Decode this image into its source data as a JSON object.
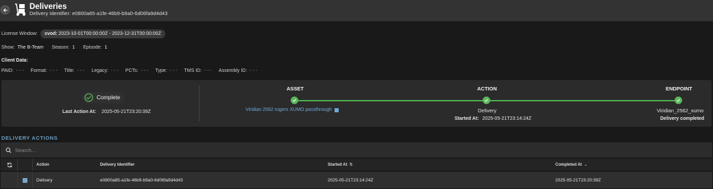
{
  "header": {
    "title": "Deliveries",
    "subtitle": "Delivery Identifier: e0800a65-a1fe-46b9-b9a0-6d06fa9d4d43"
  },
  "license": {
    "label": "License Window:",
    "type": "svod:",
    "range": "2023-10-01T00:00:00Z - 2023-12-31T00:00:00Z"
  },
  "show_info": {
    "show_label": "Show:",
    "show_value": "The B-Team",
    "season_label": "Season:",
    "season_value": "1",
    "episode_label": "Episode:",
    "episode_value": "1"
  },
  "client_data": {
    "heading": "Client Data:",
    "fields": [
      {
        "label": "PAID:",
        "value": "- - -"
      },
      {
        "label": "Format:",
        "value": "- - -"
      },
      {
        "label": "Title:",
        "value": "- - -"
      },
      {
        "label": "Legacy:",
        "value": "- - -"
      },
      {
        "label": "PCTs:",
        "value": "- - -"
      },
      {
        "label": "Type:",
        "value": "- - -"
      },
      {
        "label": "TMS ID:",
        "value": "- - -"
      },
      {
        "label": "Assembly ID:",
        "value": "- - -"
      }
    ]
  },
  "status": {
    "badge": "Complete",
    "last_action_label": "Last Action At:",
    "last_action_value": "2025-05-21T23:20:39Z"
  },
  "pipeline": {
    "asset_title": "ASSET",
    "action_title": "ACTION",
    "endpoint_title": "ENDPOINT",
    "asset_link": "Viridian 2562 rogers XUMO passthrough",
    "action_name": "Delivery",
    "started_label": "Started At:",
    "started_value": "2025-05-21T23:14:24Z",
    "endpoint_name": "Viridian_2562_xumo",
    "endpoint_status": "Delivery completed",
    "accent": "#4caf50"
  },
  "actions": {
    "section_title": "DELIVERY ACTIONS",
    "search_placeholder": "Search...",
    "columns": {
      "action": "Action",
      "delivery_identifier": "Delivery Identifier",
      "started_at": "Started At",
      "completed_at": "Completed At"
    },
    "rows": [
      {
        "action": "Delivery",
        "delivery_identifier": "e0800a65-a1fe-46b9-b9a0-6d06fa9d4d43",
        "started_at": "2025-05-21T23:14:24Z",
        "completed_at": "2025-05-21T23:20:39Z"
      }
    ]
  },
  "icons": {
    "back": "arrow-left-icon",
    "logo": "delivery-dolly-icon",
    "check": "check-circle-icon",
    "link": "external-link-icon",
    "search": "search-icon",
    "refresh": "refresh-icon",
    "sort": "sort-icon"
  }
}
